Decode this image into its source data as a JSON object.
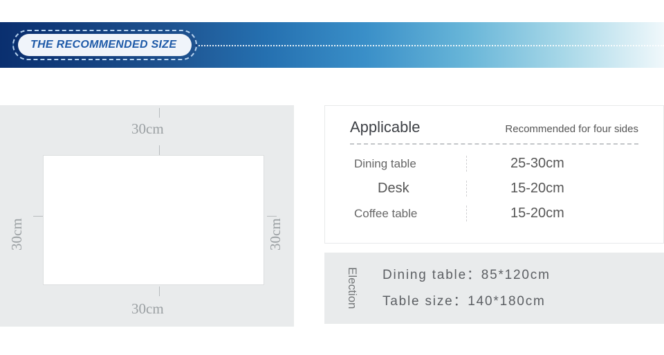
{
  "banner": {
    "title": "THE RECOMMENDED SIZE"
  },
  "diagram": {
    "top": "30cm",
    "bottom": "30cm",
    "left": "30cm",
    "right": "30cm"
  },
  "spec": {
    "title": "Applicable",
    "subtitle": "Recommended for four sides",
    "rows": [
      {
        "label": "Dining table",
        "value": "25-30cm"
      },
      {
        "label": "Desk",
        "value": "15-20cm"
      },
      {
        "label": "Coffee table",
        "value": "15-20cm"
      }
    ]
  },
  "election": {
    "label": "Election",
    "dining_label": "Dining table：",
    "dining_value": "85*120cm",
    "table_label": "Table size：",
    "table_value": "140*180cm"
  }
}
